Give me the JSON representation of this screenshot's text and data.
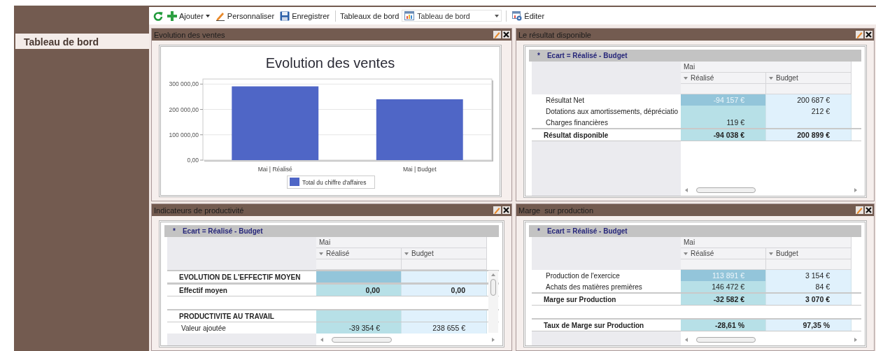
{
  "sidebar": {
    "items": [
      {
        "label": "Tableau de bord",
        "selected": true
      }
    ]
  },
  "toolbar": {
    "add_button": "Ajouter",
    "customize_button": "Personnaliser",
    "save_button": "Enregistrer",
    "dashboards_label": "Tableaux de bord",
    "dashboard_select": {
      "value": "Tableau de bord"
    },
    "edit_button": "Éditer"
  },
  "panels": [
    {
      "kind": "chart",
      "title": "Evolution des ventes",
      "chart_data": {
        "type": "bar",
        "title": "Evolution des ventes",
        "categories": [
          "Mai | Réalisé",
          "Mai | Budget"
        ],
        "series": [
          {
            "name": "Total du chiffre d'affaires",
            "color": "#4f66c6",
            "values": [
              291000,
              240000
            ]
          }
        ],
        "ylim": [
          0,
          320000
        ],
        "grid": true,
        "yticks": [
          {
            "value": 0,
            "label": "0,00"
          },
          {
            "value": 100000,
            "label": "100 000,00"
          },
          {
            "value": 200000,
            "label": "200 000,00"
          },
          {
            "value": 300000,
            "label": "300 000,00"
          }
        ]
      }
    },
    {
      "kind": "pivot",
      "title": "Le résultat disponible",
      "note": {
        "marker": "*",
        "text": "Ecart = Réalisé - Budget"
      },
      "column_group": "Mai",
      "columns": [
        "Réalisé",
        "Budget"
      ],
      "rows": [
        {
          "kind": "item",
          "label": "Résultat Net",
          "realise": "-94 157 €",
          "budget": "200 687 €",
          "selected": true
        },
        {
          "kind": "item",
          "label": "Dotations aux amortissements, dépréciatio",
          "budget": "212 €",
          "selected": false
        },
        {
          "kind": "item",
          "label": "Charges financières",
          "realise": "119 €",
          "selected": false
        },
        {
          "kind": "total",
          "label": "Résultat disponible",
          "realise": "-94 038 €",
          "budget": "200 899 €",
          "selected": false
        }
      ]
    },
    {
      "kind": "pivot",
      "title": "Indicateurs de productivité",
      "note": {
        "marker": "*",
        "text": "Ecart = Réalisé - Budget"
      },
      "column_group": "Mai",
      "columns": [
        "Réalisé",
        "Budget"
      ],
      "vertical_scroll": true,
      "rows": [
        {
          "kind": "total",
          "label": "EVOLUTION DE L'EFFECTIF MOYEN",
          "selected": true
        },
        {
          "kind": "total",
          "label": "Effectif moyen",
          "realise": "0,00",
          "budget": "0,00",
          "selected": false
        },
        {
          "kind": "gap"
        },
        {
          "kind": "total",
          "label": "PRODUCTIVITE AU TRAVAIL",
          "selected": false
        },
        {
          "kind": "item",
          "label": "Valeur ajoutée",
          "realise": "-39 354 €",
          "budget": "238 655 €",
          "selected": false
        }
      ]
    },
    {
      "kind": "pivot",
      "title": "Marge  sur production",
      "note": {
        "marker": "*",
        "text": "Ecart = Réalisé - Budget"
      },
      "column_group": "Mai",
      "columns": [
        "Réalisé",
        "Budget"
      ],
      "rows": [
        {
          "kind": "item",
          "label": "Production de l'exercice",
          "realise": "113 891 €",
          "budget": "3 154 €",
          "selected": true
        },
        {
          "kind": "item",
          "label": "Achats des matières premières",
          "realise": "146 472 €",
          "budget": "84 €",
          "selected": false
        },
        {
          "kind": "total",
          "label": "Marge sur Production",
          "realise": "-32 582 €",
          "budget": "3 070 €",
          "selected": false
        },
        {
          "kind": "gap"
        },
        {
          "kind": "total",
          "label": "Taux de Marge sur Production",
          "realise": "-28,61 %",
          "budget": "97,35 %",
          "selected": false
        }
      ]
    }
  ]
}
